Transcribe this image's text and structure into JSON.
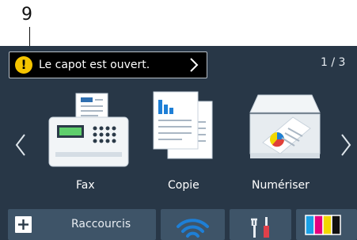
{
  "callout": {
    "number": "9"
  },
  "status": {
    "message": "Le capot est ouvert.",
    "icon": "warning-icon",
    "icon_glyph": "!"
  },
  "pager": {
    "indicator": "1 / 3"
  },
  "apps": [
    {
      "label": "Fax",
      "icon": "fax-icon"
    },
    {
      "label": "Copie",
      "icon": "copy-icon"
    },
    {
      "label": "Numériser",
      "icon": "scan-icon"
    }
  ],
  "bottom": {
    "shortcuts_label": "Raccourcis",
    "wifi_icon": "wifi-icon",
    "tools_icon": "tools-icon",
    "toner_icon": "toner-icon",
    "toner_colors": [
      "#1aa0e6",
      "#e6007e",
      "#f2d800",
      "#111111"
    ]
  },
  "colors": {
    "screen_bg": "#283747",
    "button_bg": "#3e5468",
    "warning": "#f5c400",
    "wifi": "#1e7fd6"
  }
}
